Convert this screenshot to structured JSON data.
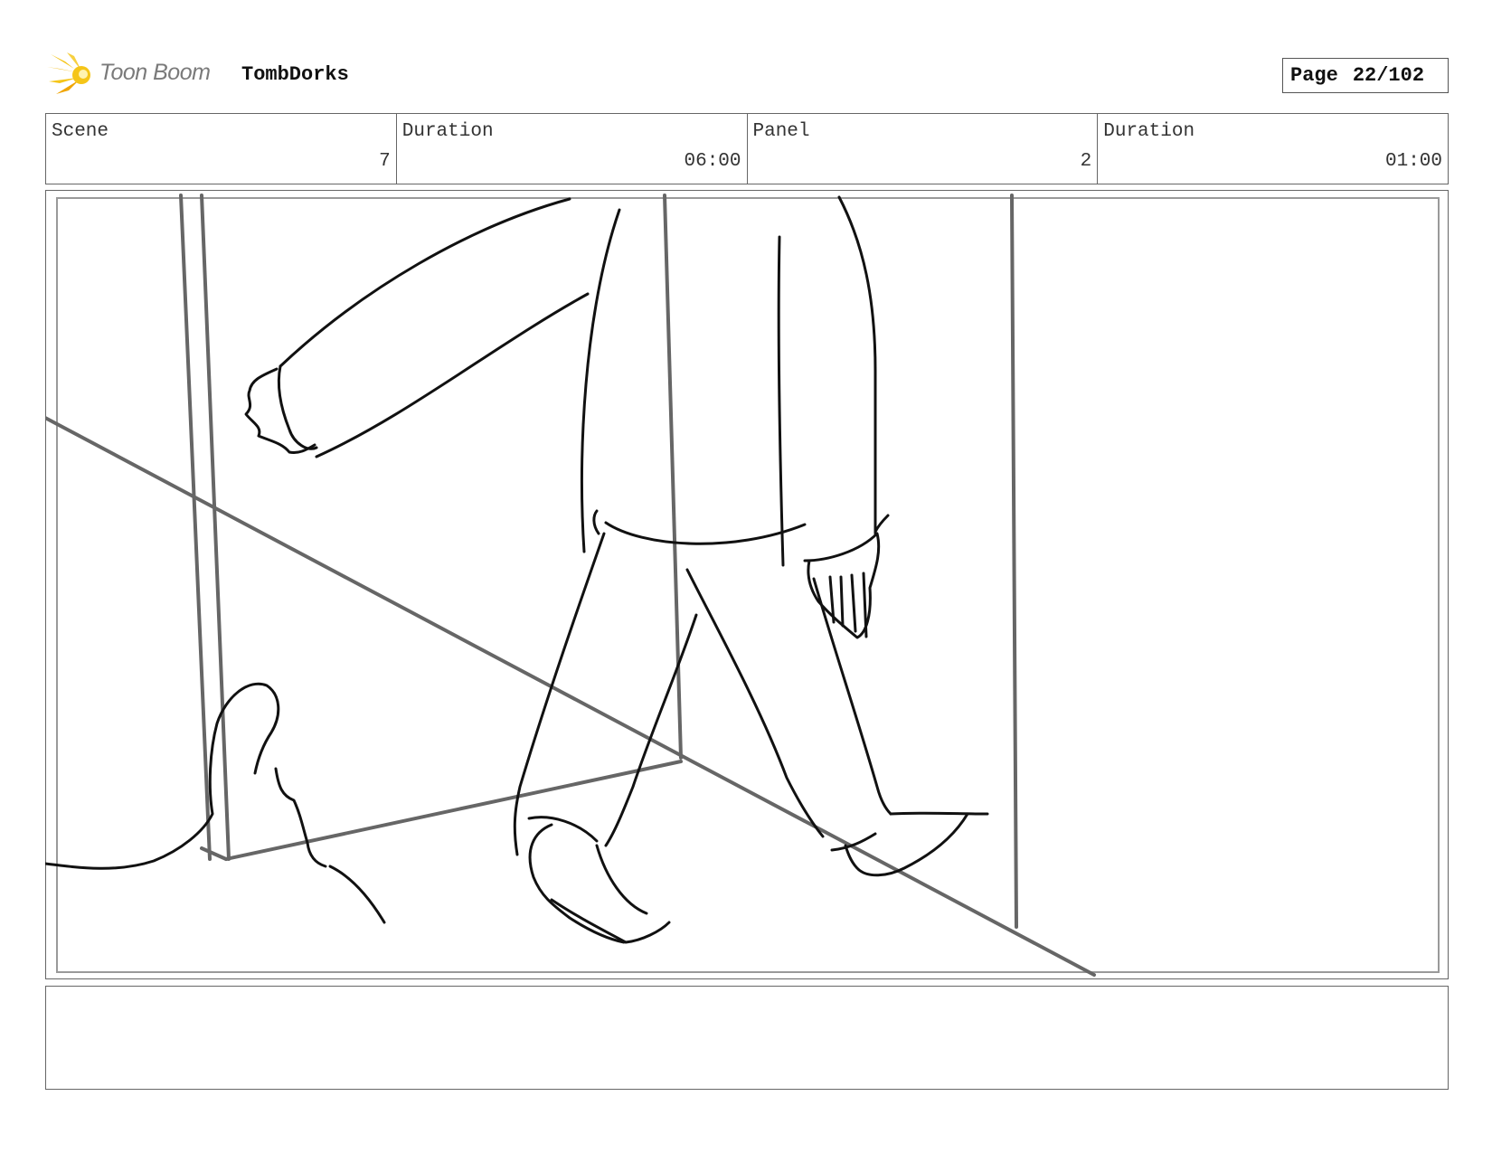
{
  "header": {
    "brand": "Toon Boom",
    "brand_icon": "toon-boom-burst-icon",
    "project": "TombDorks",
    "page_label": "Page",
    "page_value": "22/102"
  },
  "info": {
    "scene_label": "Scene",
    "scene_value": "7",
    "scene_duration_label": "Duration",
    "scene_duration_value": "06:00",
    "panel_label": "Panel",
    "panel_value": "2",
    "panel_duration_label": "Duration",
    "panel_duration_value": "01:00"
  },
  "notes": {
    "text": ""
  },
  "colors": {
    "logo_yellow": "#f5c518",
    "logo_orange": "#f0a500",
    "border": "#666666",
    "sketch_line": "#111111",
    "guide_line": "#666666"
  }
}
